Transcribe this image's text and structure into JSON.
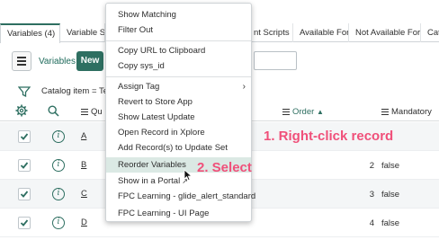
{
  "tabs": [
    {
      "label": "Variables (4)",
      "active": true
    },
    {
      "label": "Variable Se",
      "active": false
    },
    {
      "label": "nt Scripts",
      "active": false
    },
    {
      "label": "Available For",
      "active": false
    },
    {
      "label": "Not Available For",
      "active": false
    },
    {
      "label": "Cate",
      "active": false
    }
  ],
  "toolbar": {
    "title": "Variables",
    "new_label": "New"
  },
  "filter": {
    "text": "Catalog item = Tes"
  },
  "columns": {
    "question": "Qu",
    "order": "Order",
    "order_sort": "▲",
    "mandatory": "Mandatory"
  },
  "rows": [
    {
      "question": "A",
      "order": "",
      "mandatory": ""
    },
    {
      "question": "B",
      "order": "2",
      "mandatory": "false"
    },
    {
      "question": "C",
      "order": "3",
      "mandatory": "false"
    },
    {
      "question": "D",
      "order": "4",
      "mandatory": "false"
    }
  ],
  "context_menu": {
    "items": [
      {
        "label": "Show Matching"
      },
      {
        "label": "Filter Out"
      },
      {
        "label": "Copy URL to Clipboard"
      },
      {
        "label": "Copy sys_id"
      },
      {
        "label": "Assign Tag",
        "submenu": "›"
      },
      {
        "label": "Revert to Store App"
      },
      {
        "label": "Show Latest Update"
      },
      {
        "label": "Open Record in Xplore"
      },
      {
        "label": "Add Record(s) to Update Set"
      },
      {
        "label": "Reorder Variables",
        "highlighted": true
      },
      {
        "label": "Show in a Portal",
        "suffix": "↗"
      },
      {
        "label": "FPC Learning - glide_alert_standard"
      },
      {
        "label": "FPC Learning - UI Page"
      }
    ]
  },
  "annotations": {
    "step1": "1. Right-click record",
    "step2": "2. Select"
  },
  "colors": {
    "accent": "#2e6f61",
    "callout": "#f0507a",
    "highlight": "#dbe9e4"
  }
}
